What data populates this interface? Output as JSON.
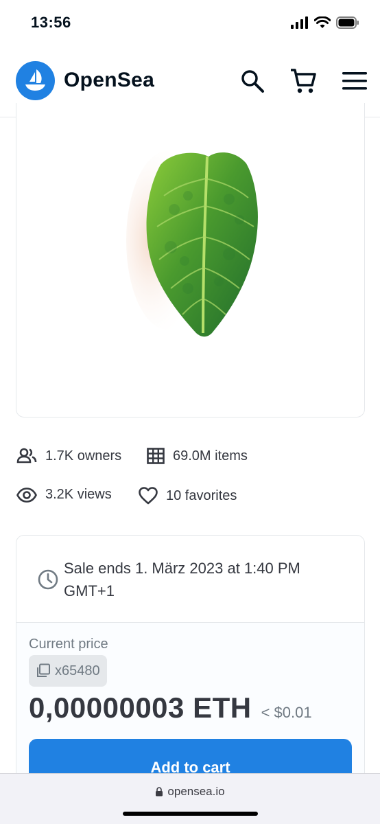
{
  "status_bar": {
    "time": "13:56"
  },
  "header": {
    "brand": "OpenSea"
  },
  "stats": {
    "owners": "1.7K owners",
    "items": "69.0M items",
    "views": "3.2K views",
    "favorites": "10 favorites"
  },
  "sale": {
    "ends_text": "Sale ends 1. März 2023 at 1:40 PM GMT+1",
    "current_price_label": "Current price",
    "quantity": "x65480",
    "price": "0,00000003 ETH",
    "usd": "< $0.01",
    "add_to_cart_label": "Add to cart"
  },
  "browser": {
    "url": "opensea.io"
  },
  "colors": {
    "accent": "#2081e2",
    "text": "#04111d",
    "muted": "#707a83"
  }
}
